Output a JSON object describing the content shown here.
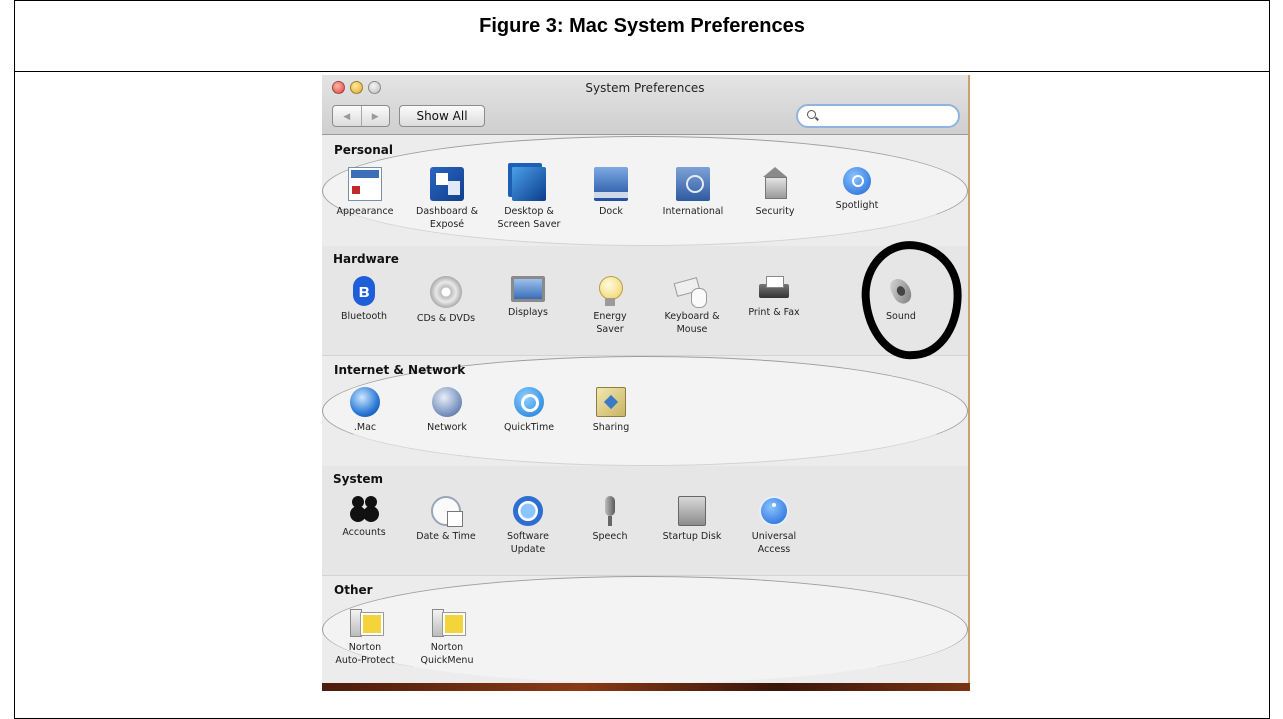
{
  "caption": "Figure 3: Mac System Preferences",
  "window": {
    "title": "System Preferences",
    "back_label": "◀",
    "forward_label": "▶",
    "show_all_label": "Show All",
    "search_value": ""
  },
  "sections": {
    "personal": {
      "title": "Personal",
      "items": [
        {
          "label": "Appearance",
          "icon": "appearance-icon"
        },
        {
          "label": "Dashboard &\nExposé",
          "icon": "dashboard-icon"
        },
        {
          "label": "Desktop &\nScreen Saver",
          "icon": "desktop-icon"
        },
        {
          "label": "Dock",
          "icon": "dock-icon"
        },
        {
          "label": "International",
          "icon": "international-flag-icon"
        },
        {
          "label": "Security",
          "icon": "house-lock-icon"
        },
        {
          "label": "Spotlight",
          "icon": "magnifier-icon"
        }
      ]
    },
    "hardware": {
      "title": "Hardware",
      "items": [
        {
          "label": "Bluetooth",
          "icon": "bluetooth-icon"
        },
        {
          "label": "CDs & DVDs",
          "icon": "disc-icon"
        },
        {
          "label": "Displays",
          "icon": "monitor-icon"
        },
        {
          "label": "Energy\nSaver",
          "icon": "lightbulb-icon"
        },
        {
          "label": "Keyboard &\nMouse",
          "icon": "keyboard-mouse-icon"
        },
        {
          "label": "Print & Fax",
          "icon": "printer-icon"
        },
        {
          "label": "Sound",
          "icon": "speaker-icon"
        }
      ]
    },
    "internet": {
      "title": "Internet & Network",
      "items": [
        {
          "label": ".Mac",
          "icon": "globe-icon"
        },
        {
          "label": "Network",
          "icon": "network-globe-icon"
        },
        {
          "label": "QuickTime",
          "icon": "quicktime-icon"
        },
        {
          "label": "Sharing",
          "icon": "sharing-folder-icon"
        }
      ]
    },
    "system": {
      "title": "System",
      "items": [
        {
          "label": "Accounts",
          "icon": "users-icon"
        },
        {
          "label": "Date & Time",
          "icon": "clock-calendar-icon"
        },
        {
          "label": "Software\nUpdate",
          "icon": "update-arrows-icon"
        },
        {
          "label": "Speech",
          "icon": "microphone-icon"
        },
        {
          "label": "Startup Disk",
          "icon": "hard-disk-icon"
        },
        {
          "label": "Universal\nAccess",
          "icon": "accessibility-icon"
        }
      ]
    },
    "other": {
      "title": "Other",
      "items": [
        {
          "label": "Norton\nAuto-Protect",
          "icon": "norton-check-icon"
        },
        {
          "label": "Norton\nQuickMenu",
          "icon": "norton-menu-icon"
        }
      ]
    }
  },
  "annotation": {
    "highlighted_item": "Sound",
    "mark_color": "#000000"
  }
}
